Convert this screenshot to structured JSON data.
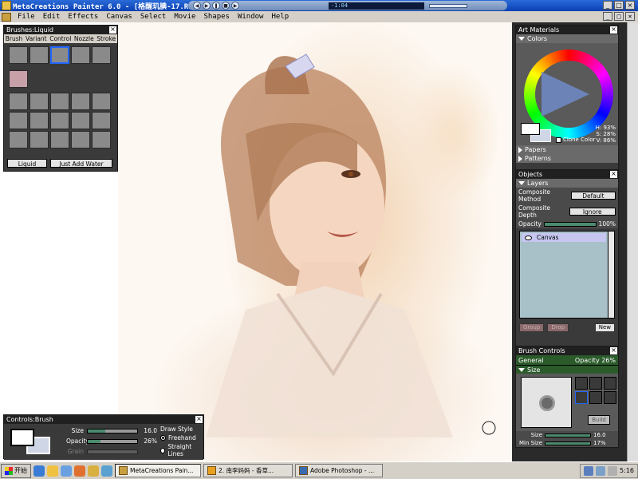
{
  "window": {
    "title": "MetaCreations Painter 6.0 - [格醒玑腆-17.RIF @ 100%]",
    "player_display": "-1:04"
  },
  "menu": {
    "items": [
      "File",
      "Edit",
      "Effects",
      "Canvas",
      "Select",
      "Movie",
      "Shapes",
      "Window",
      "Help"
    ]
  },
  "brushes_palette": {
    "title": "Brushes:Liquid",
    "menus": [
      "Brush",
      "Variant",
      "Control",
      "Nozzle",
      "Stroke"
    ],
    "brush_name": "Liquid",
    "variant_name": "Just Add Water"
  },
  "controls_palette": {
    "title": "Controls:Brush",
    "size_label": "Size",
    "size_value": "16.0",
    "size_fraction": 0.35,
    "opacity_label": "Opacity",
    "opacity_value": "26%",
    "opacity_fraction": 0.26,
    "grain_label": "Grain",
    "draw_style_label": "Draw Style",
    "freehand_label": "Freehand",
    "straight_label": "Straight Lines",
    "selected_style": "freehand"
  },
  "art_materials": {
    "title": "Art Materials",
    "colors_label": "Colors",
    "h_value": "H: 93%",
    "s_value": "S: 28%",
    "v_value": "V: 86%",
    "clone_color_label": "Clone Color",
    "papers_label": "Papers",
    "patterns_label": "Patterns"
  },
  "objects": {
    "title": "Objects",
    "layers_label": "Layers",
    "composite_method_label": "Composite Method",
    "composite_method_value": "Default",
    "composite_depth_label": "Composite Depth",
    "composite_depth_value": "Ignore",
    "opacity_label": "Opacity",
    "opacity_value": "100%",
    "layer_name": "Canvas",
    "group_label": "Group",
    "drop_label": "Drop",
    "new_label": "New"
  },
  "brush_controls": {
    "title": "Brush Controls",
    "general_label": "General",
    "general_opacity": "Opacity 26%",
    "size_section_label": "Size",
    "build_label": "Build",
    "size_label": "Size",
    "size_value": "16.0",
    "min_size_label": "Min Size",
    "min_size_value": "17%"
  },
  "taskbar": {
    "start_label": "开始",
    "task1": "MetaCreations Pain...",
    "task2": "2. 南李妈妈 - 香草...",
    "task3": "Adobe Photoshop - ...",
    "clock": "5:16"
  },
  "colors": {
    "accent": "#2b5a2b",
    "title_bar": "#0a3fb3",
    "selected_swatch": "#cfd7e6"
  }
}
